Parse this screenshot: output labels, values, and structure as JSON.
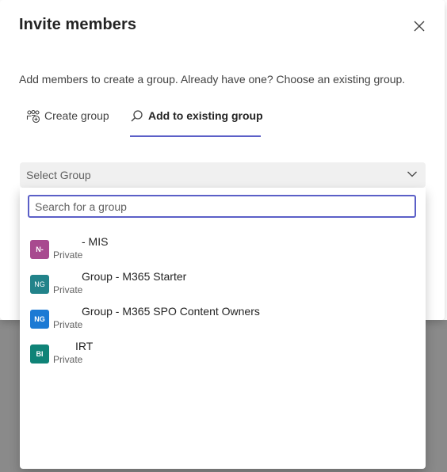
{
  "dialog": {
    "title": "Invite members",
    "description": "Add members to create a group. Already have one? Choose an existing group."
  },
  "tabs": [
    {
      "label": "Create group",
      "icon": "people-add-icon",
      "active": false
    },
    {
      "label": "Add to existing group",
      "icon": "search-icon",
      "active": true
    }
  ],
  "select": {
    "placeholder": "Select Group"
  },
  "search": {
    "placeholder": "Search for a group"
  },
  "groups": [
    {
      "initials": "N-",
      "name": "- MIS",
      "sub": "Private",
      "color": "#a84a8f"
    },
    {
      "initials": "NG",
      "name": "Group - M365 Starter",
      "sub": "Private",
      "color": "#22838a"
    },
    {
      "initials": "NG",
      "name": "Group - M365 SPO Content Owners",
      "sub": "Private",
      "color": "#1c7ad4"
    },
    {
      "initials": "BI",
      "name": "IRT",
      "sub": "Private",
      "color": "#0f8377"
    }
  ],
  "colors": {
    "accent": "#5b5fc7",
    "overlay": "#8a8a8a"
  }
}
